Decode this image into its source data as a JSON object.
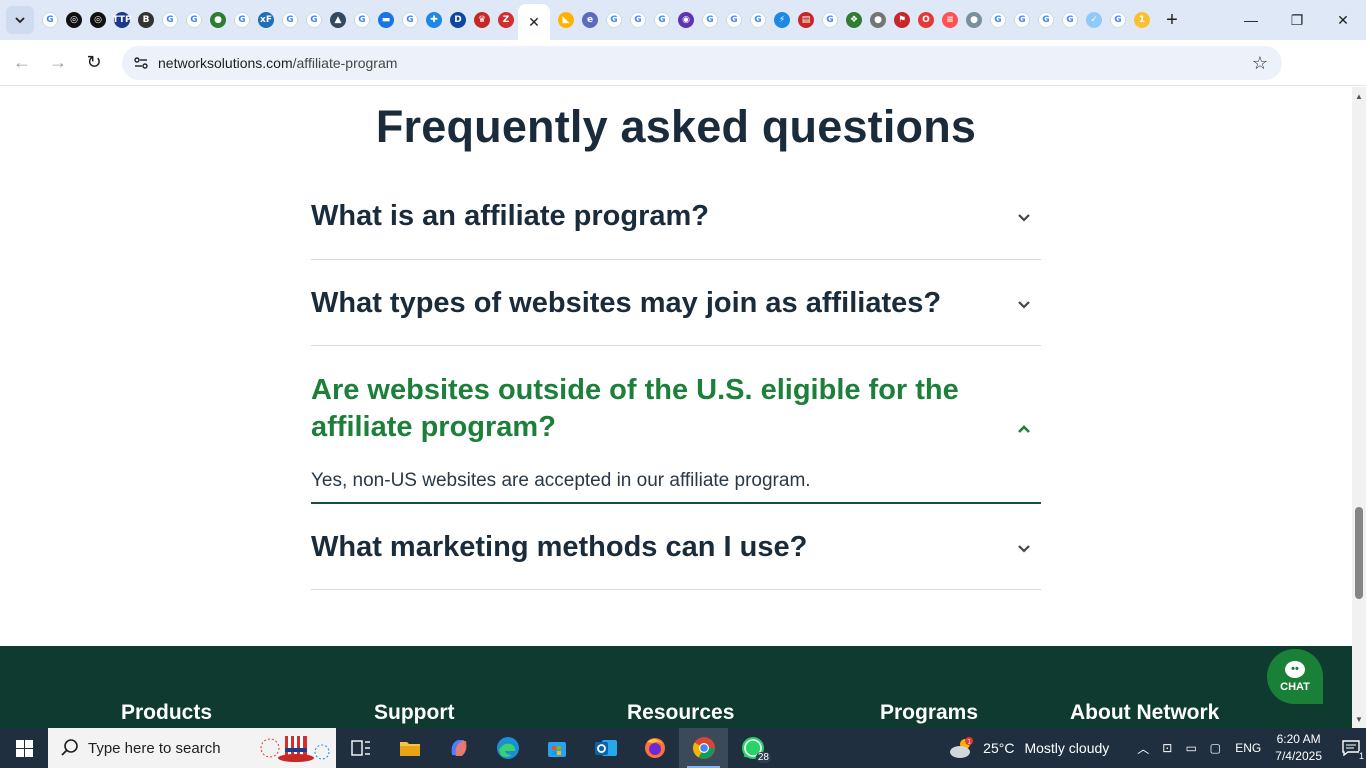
{
  "browser": {
    "tab_icons": [
      {
        "name": "google-icon",
        "glyph": "G",
        "color": "#4285f4"
      },
      {
        "name": "openai-icon",
        "glyph": "◎",
        "color": "#111111"
      },
      {
        "name": "openai-icon",
        "glyph": "◎",
        "color": "#111111"
      },
      {
        "name": "ttp-icon",
        "glyph": "TTP",
        "color": "#1b3a8a"
      },
      {
        "name": "b-icon",
        "glyph": "B",
        "color": "#333333"
      },
      {
        "name": "google-icon",
        "glyph": "G",
        "color": "#4285f4"
      },
      {
        "name": "google-icon",
        "glyph": "G",
        "color": "#4285f4"
      },
      {
        "name": "globe-icon",
        "glyph": "●",
        "color": "#2e7d32"
      },
      {
        "name": "google-icon",
        "glyph": "G",
        "color": "#4285f4"
      },
      {
        "name": "xf-icon",
        "glyph": "xF",
        "color": "#1e6fb8"
      },
      {
        "name": "google-icon",
        "glyph": "G",
        "color": "#4285f4"
      },
      {
        "name": "google-icon",
        "glyph": "G",
        "color": "#4285f4"
      },
      {
        "name": "grad-cap-icon",
        "glyph": "▲",
        "color": "#34495e"
      },
      {
        "name": "google-icon",
        "glyph": "G",
        "color": "#4285f4"
      },
      {
        "name": "tag-icon",
        "glyph": "▬",
        "color": "#1a73e8"
      },
      {
        "name": "google-icon",
        "glyph": "G",
        "color": "#4285f4"
      },
      {
        "name": "puzzle-icon",
        "glyph": "✚",
        "color": "#1e88e5"
      },
      {
        "name": "d-icon",
        "glyph": "D",
        "color": "#0d47a1"
      },
      {
        "name": "crown-icon",
        "glyph": "♛",
        "color": "#c62828"
      },
      {
        "name": "z-icon",
        "glyph": "Z",
        "color": "#d32f2f"
      }
    ],
    "tab_icons_after": [
      {
        "name": "chart-icon",
        "glyph": "◣",
        "color": "#ffb300"
      },
      {
        "name": "e-icon",
        "glyph": "e",
        "color": "#5c6bc0"
      },
      {
        "name": "google-icon",
        "glyph": "G",
        "color": "#4285f4"
      },
      {
        "name": "google-icon",
        "glyph": "G",
        "color": "#4285f4"
      },
      {
        "name": "google-icon",
        "glyph": "G",
        "color": "#4285f4"
      },
      {
        "name": "circle-icon",
        "glyph": "◉",
        "color": "#5e35b1"
      },
      {
        "name": "google-icon",
        "glyph": "G",
        "color": "#4285f4"
      },
      {
        "name": "google-icon",
        "glyph": "G",
        "color": "#4285f4"
      },
      {
        "name": "google-icon",
        "glyph": "G",
        "color": "#4285f4"
      },
      {
        "name": "bolt-icon",
        "glyph": "⚡",
        "color": "#1e88e5"
      },
      {
        "name": "book-icon",
        "glyph": "▤",
        "color": "#c62828"
      },
      {
        "name": "google-icon",
        "glyph": "G",
        "color": "#4285f4"
      },
      {
        "name": "leaf-icon",
        "glyph": "❖",
        "color": "#2e7d32"
      },
      {
        "name": "avatar-icon",
        "glyph": "●",
        "color": "#757575"
      },
      {
        "name": "flag-icon",
        "glyph": "⚑",
        "color": "#c62828"
      },
      {
        "name": "opera-icon",
        "glyph": "O",
        "color": "#e53935"
      },
      {
        "name": "stripes-icon",
        "glyph": "≡",
        "color": "#ff5252"
      },
      {
        "name": "globe-icon",
        "glyph": "●",
        "color": "#78909c"
      },
      {
        "name": "google-icon",
        "glyph": "G",
        "color": "#4285f4"
      },
      {
        "name": "google-icon",
        "glyph": "G",
        "color": "#4285f4"
      },
      {
        "name": "google-icon",
        "glyph": "G",
        "color": "#4285f4"
      },
      {
        "name": "google-icon",
        "glyph": "G",
        "color": "#4285f4"
      },
      {
        "name": "check-icon",
        "glyph": "✓",
        "color": "#90caf9"
      },
      {
        "name": "google-icon",
        "glyph": "G",
        "color": "#4285f4"
      },
      {
        "name": "one-icon",
        "glyph": "1",
        "color": "#fbc02d"
      }
    ],
    "url_domain": "networksolutions.com",
    "url_path": "/affiliate-program"
  },
  "page": {
    "title": "Frequently asked questions",
    "faq": [
      {
        "question": "What is an affiliate program?",
        "expanded": false
      },
      {
        "question": "What types of websites may join as affiliates?",
        "expanded": false
      },
      {
        "question": "Are websites outside of the U.S. eligible for the affiliate program?",
        "expanded": true,
        "answer": "Yes, non-US websites are accepted in our affiliate program."
      },
      {
        "question": "What marketing methods can I use?",
        "expanded": false
      }
    ],
    "accent_color": "#1c7f3a",
    "footer": {
      "columns": [
        "Products",
        "Support",
        "Resources",
        "Programs",
        "About Network"
      ]
    },
    "chat_label": "CHAT"
  },
  "taskbar": {
    "search_placeholder": "Type here to search",
    "whatsapp_badge": "28",
    "weather_temp": "25°C",
    "weather_condition": "Mostly cloudy",
    "weather_alert": "1",
    "language": "ENG",
    "time": "6:20 AM",
    "date": "7/4/2025",
    "notification_count": "1"
  }
}
